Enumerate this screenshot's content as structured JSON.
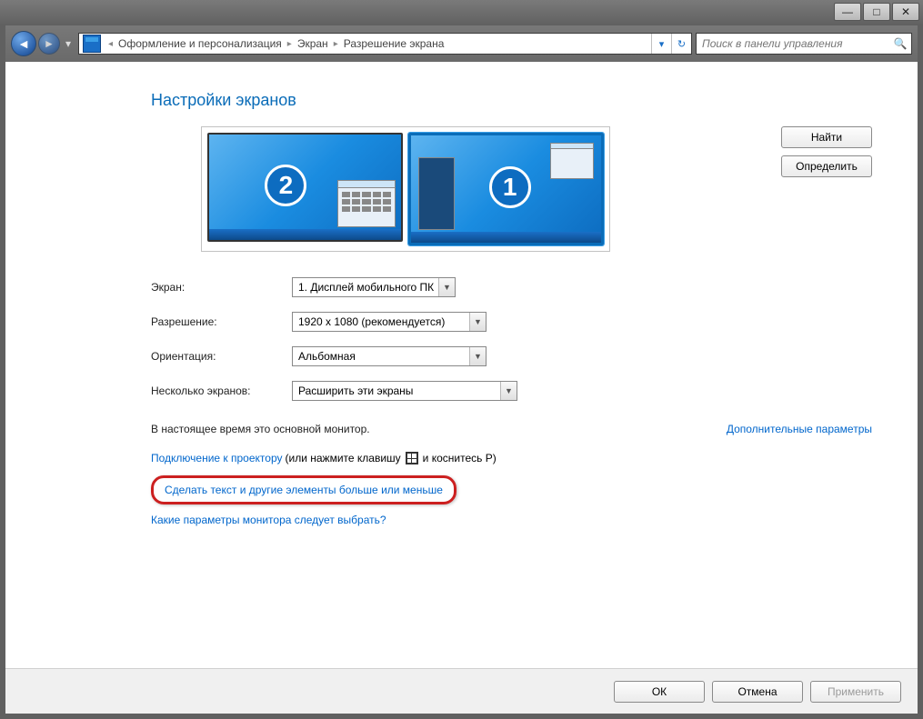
{
  "titlebar": {
    "min": "—",
    "max": "□",
    "close": "✕"
  },
  "breadcrumb": {
    "seg1": "Оформление и персонализация",
    "seg2": "Экран",
    "seg3": "Разрешение экрана"
  },
  "search": {
    "placeholder": "Поиск в панели управления"
  },
  "heading": "Настройки экранов",
  "buttons": {
    "detect": "Найти",
    "identify": "Определить"
  },
  "displays": {
    "d1": "1",
    "d2": "2"
  },
  "form": {
    "display_label": "Экран:",
    "display_value": "1. Дисплей мобильного ПК",
    "resolution_label": "Разрешение:",
    "resolution_value": "1920 x 1080 (рекомендуется)",
    "orientation_label": "Ориентация:",
    "orientation_value": "Альбомная",
    "multi_label": "Несколько экранов:",
    "multi_value": "Расширить эти экраны"
  },
  "status": "В настоящее время это основной монитор.",
  "adv_link": "Дополнительные параметры",
  "projector_link": "Подключение к проектору",
  "projector_hint_a": "(или нажмите клавишу",
  "projector_hint_b": "и коснитесь P)",
  "textsize_link": "Сделать текст и другие элементы больше или меньше",
  "whichmon_link": "Какие параметры монитора следует выбрать?",
  "footer": {
    "ok": "ОК",
    "cancel": "Отмена",
    "apply": "Применить"
  }
}
